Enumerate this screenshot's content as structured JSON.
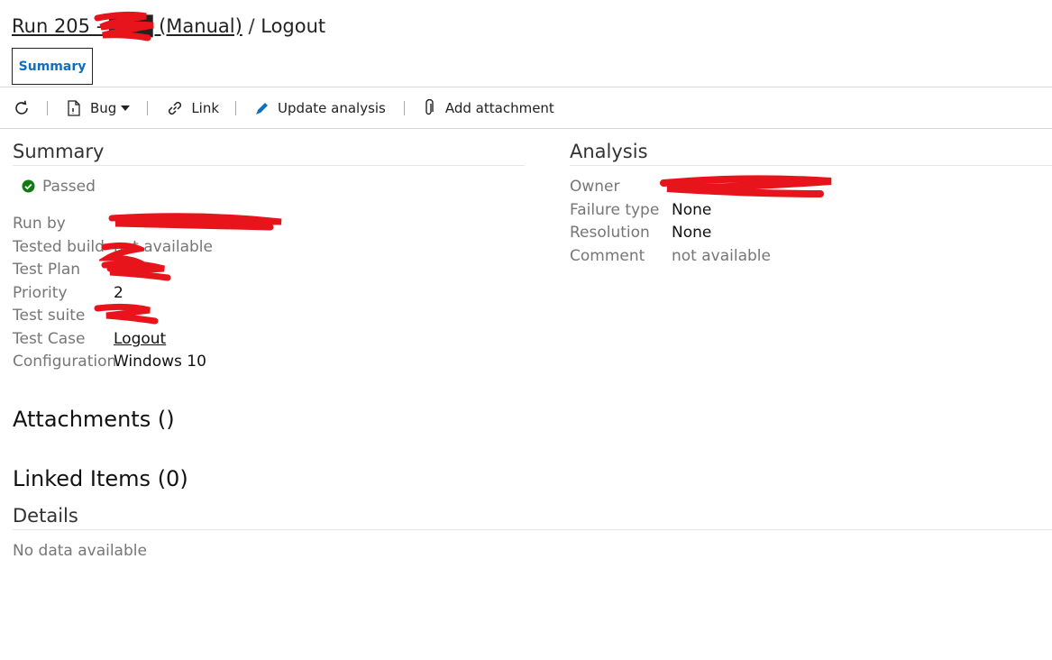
{
  "breadcrumb": {
    "run_link": "Run 205 - ███ (Manual)",
    "separator": "/",
    "current": "Logout"
  },
  "tabs": [
    {
      "label": "Summary",
      "active": true
    }
  ],
  "toolbar": {
    "refresh_icon": "refresh-icon",
    "bug_label": "Bug",
    "link_label": "Link",
    "update_analysis_label": "Update analysis",
    "add_attachment_label": "Add attachment"
  },
  "summary": {
    "title": "Summary",
    "outcome": "Passed",
    "outcome_color": "#107c10",
    "fields": [
      {
        "label": "Run by",
        "value": ""
      },
      {
        "label": "Tested build",
        "value": "not available"
      },
      {
        "label": "Test Plan",
        "value": ""
      },
      {
        "label": "Priority",
        "value": "2"
      },
      {
        "label": "Test suite",
        "value": ""
      },
      {
        "label": "Test Case",
        "value": "Logout"
      },
      {
        "label": "Configuration",
        "value": "Windows 10"
      }
    ]
  },
  "analysis": {
    "title": "Analysis",
    "fields": [
      {
        "label": "Owner",
        "value": ""
      },
      {
        "label": "Failure type",
        "value": "None"
      },
      {
        "label": "Resolution",
        "value": "None"
      },
      {
        "label": "Comment",
        "value": "not available"
      }
    ]
  },
  "attachments": {
    "title": "Attachments ()"
  },
  "linked_items": {
    "title": "Linked Items (0)"
  },
  "details": {
    "title": "Details",
    "empty_text": "No data available"
  },
  "colors": {
    "accent": "#106ebe",
    "redaction": "#e8141c"
  }
}
